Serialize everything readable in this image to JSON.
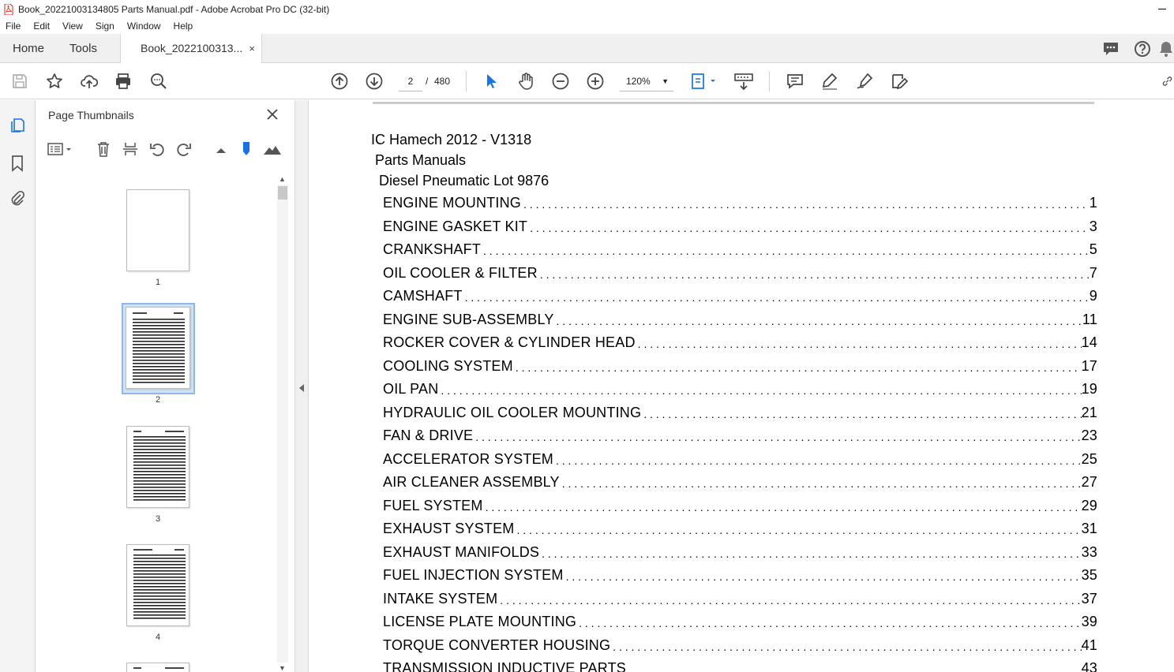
{
  "window": {
    "title": "Book_20221003134805 Parts Manual.pdf - Adobe Acrobat Pro DC (32-bit)"
  },
  "menu": [
    "File",
    "Edit",
    "View",
    "Sign",
    "Window",
    "Help"
  ],
  "tabs": {
    "home": "Home",
    "tools": "Tools",
    "document": "Book_2022100313...",
    "close": "×"
  },
  "toolbar": {
    "current_page": "2",
    "page_separator": "/",
    "total_pages": "480",
    "zoom": "120%"
  },
  "thumbnails_panel": {
    "title": "Page Thumbnails",
    "close": "✕",
    "pages": [
      {
        "label": "1"
      },
      {
        "label": "2"
      },
      {
        "label": "3"
      },
      {
        "label": "4"
      }
    ],
    "selected_page": "2"
  },
  "document": {
    "heading_1": "IC Hamech 2012 - V1318",
    "heading_2": "Parts Manuals",
    "heading_3": "Diesel Pneumatic Lot 9876",
    "toc": [
      {
        "title": "ENGINE MOUNTING",
        "page": "1"
      },
      {
        "title": "ENGINE GASKET KIT",
        "page": "3"
      },
      {
        "title": "CRANKSHAFT",
        "page": "5"
      },
      {
        "title": "OIL COOLER & FILTER",
        "page": "7"
      },
      {
        "title": "CAMSHAFT",
        "page": "9"
      },
      {
        "title": "ENGINE SUB-ASSEMBLY",
        "page": "11"
      },
      {
        "title": "ROCKER COVER & CYLINDER HEAD",
        "page": "14"
      },
      {
        "title": "COOLING SYSTEM",
        "page": "17"
      },
      {
        "title": "OIL PAN",
        "page": "19"
      },
      {
        "title": "HYDRAULIC OIL COOLER MOUNTING",
        "page": "21"
      },
      {
        "title": "FAN & DRIVE",
        "page": "23"
      },
      {
        "title": "ACCELERATOR SYSTEM",
        "page": "25"
      },
      {
        "title": "AIR CLEANER ASSEMBLY",
        "page": "27"
      },
      {
        "title": "FUEL SYSTEM",
        "page": "29"
      },
      {
        "title": "EXHAUST SYSTEM",
        "page": "31"
      },
      {
        "title": "EXHAUST MANIFOLDS",
        "page": "33"
      },
      {
        "title": "FUEL INJECTION SYSTEM",
        "page": "35"
      },
      {
        "title": "INTAKE SYSTEM",
        "page": "37"
      },
      {
        "title": "LICENSE PLATE MOUNTING",
        "page": "39"
      },
      {
        "title": "TORQUE CONVERTER HOUSING",
        "page": "41"
      },
      {
        "title": "TRANSMISSION INDUCTIVE PARTS",
        "page": "43"
      }
    ]
  },
  "colors": {
    "accent_blue": "#1473e6",
    "selection_frame": "#8fb8e6",
    "pdf_red": "#d9241c"
  }
}
